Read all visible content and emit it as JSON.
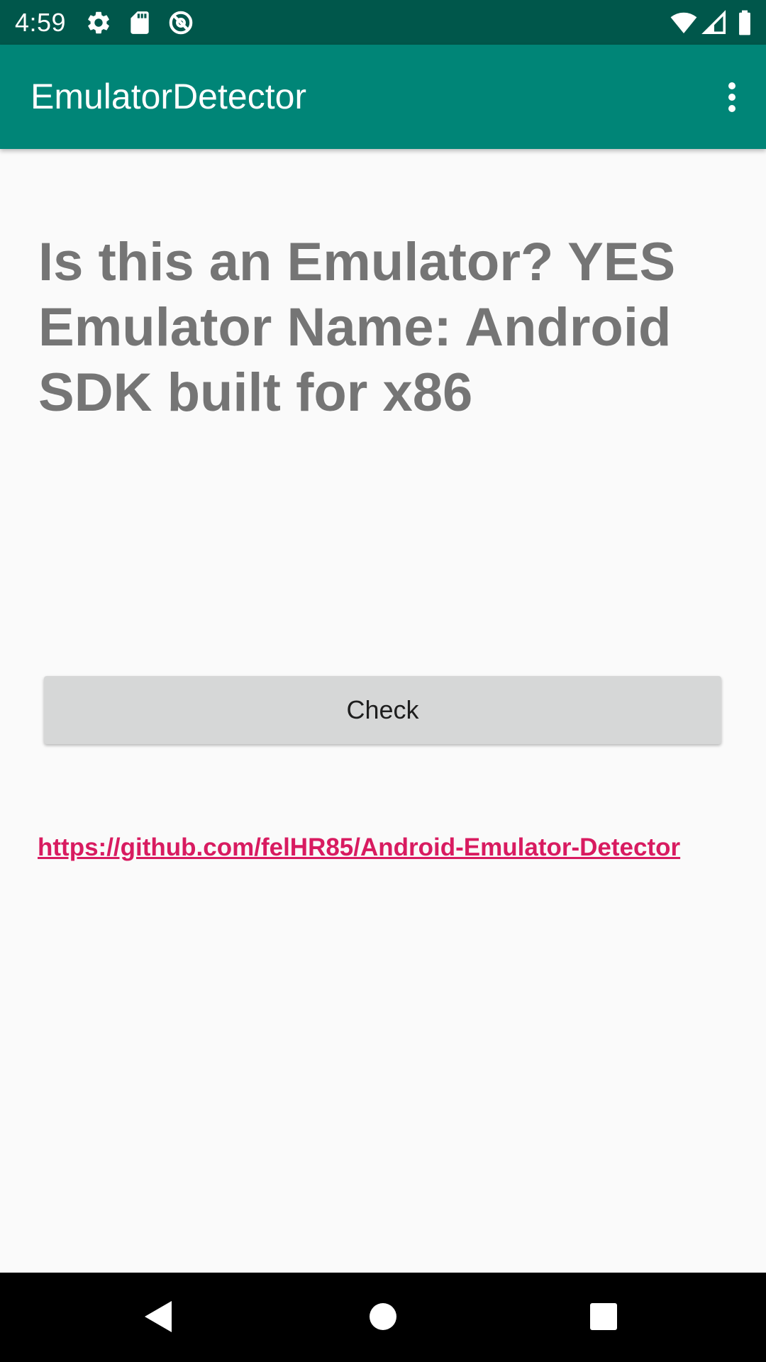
{
  "status_bar": {
    "time": "4:59",
    "left_icons": [
      "gear-icon",
      "sd-card-icon",
      "sync-disabled-icon"
    ],
    "right_icons": [
      "wifi-icon",
      "cellular-signal-icon",
      "battery-icon"
    ]
  },
  "app_bar": {
    "title": "EmulatorDetector",
    "menu_icon": "more-vert-icon"
  },
  "main": {
    "result_text": "Is this an Emulator? YES\nEmulator Name: Android\nSDK built for x86",
    "check_button_label": "Check",
    "repo_link": "https://github.com/felHR85/Android-Emulator-Detector"
  },
  "nav_bar": {
    "icons": [
      "back-icon",
      "home-icon",
      "recents-icon"
    ]
  },
  "colors": {
    "status_bar": "#00574B",
    "app_bar": "#008577",
    "background": "#FAFAFA",
    "result_text": "#757575",
    "button": "#D6D7D7",
    "link": "#D81B60"
  }
}
